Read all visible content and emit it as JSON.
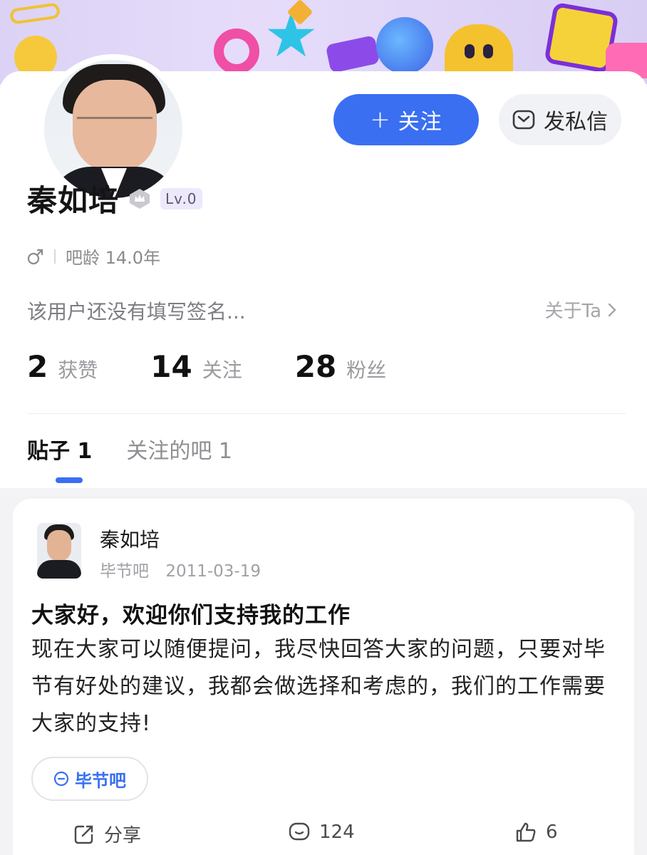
{
  "profile": {
    "name": "秦如培",
    "level": "Lv.0",
    "tenure": "吧龄 14.0年",
    "signature": "该用户还没有填写签名...",
    "about_label": "关于Ta",
    "follow_label": "关注",
    "message_label": "发私信"
  },
  "stats": [
    {
      "value": "2",
      "label": "获赞"
    },
    {
      "value": "14",
      "label": "关注"
    },
    {
      "value": "28",
      "label": "粉丝"
    }
  ],
  "tabs": [
    {
      "label": "贴子",
      "count": "1",
      "active": true
    },
    {
      "label": "关注的吧",
      "count": "1",
      "active": false
    }
  ],
  "post": {
    "author": "秦如培",
    "forum": "毕节吧",
    "date": "2011-03-19",
    "title": "大家好，欢迎你们支持我的工作",
    "body": "现在大家可以随便提问，我尽快回答大家的问题，只要对毕节有好处的建议，我都会做选择和考虑的，我们的工作需要大家的支持!",
    "forum_chip": "毕节吧",
    "share_label": "分享",
    "comment_count": "124",
    "like_count": "6"
  },
  "colors": {
    "accent": "#3a6ff2",
    "banner": "#dcd2f5"
  },
  "icons": [
    "crown-icon",
    "gender-male-icon",
    "chevron-right-icon",
    "message-icon",
    "forum-icon",
    "share-icon",
    "comment-icon",
    "like-icon"
  ]
}
